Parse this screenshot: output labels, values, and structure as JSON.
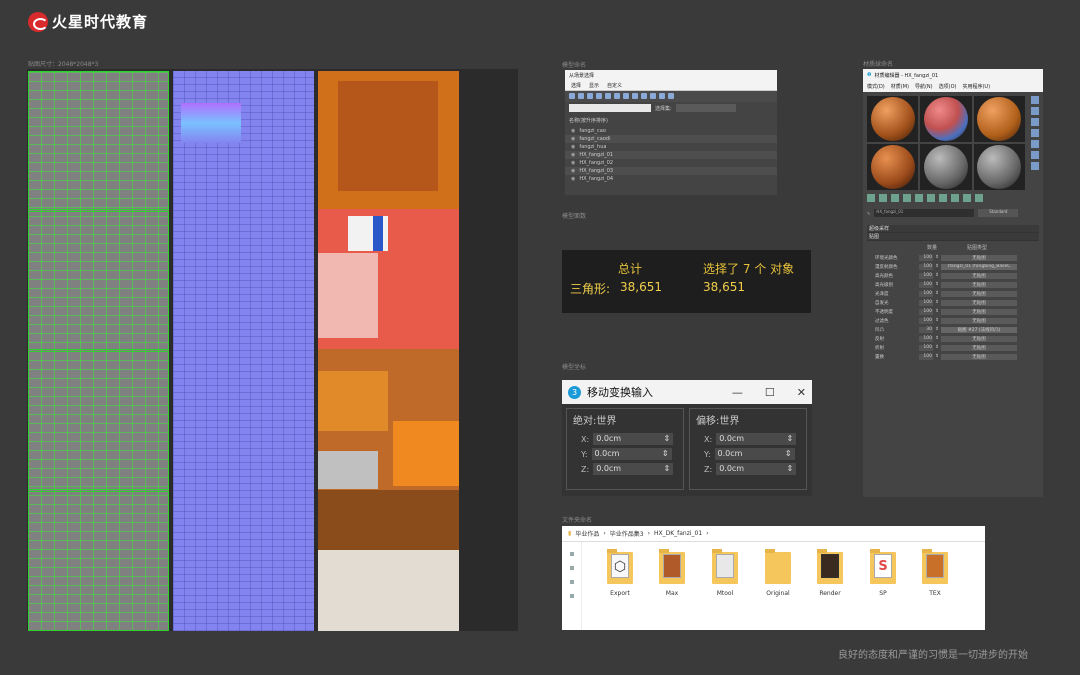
{
  "brand": {
    "logo_text": "火星时代教育"
  },
  "captions": {
    "texture": "贴图尺寸：2048*2048*3",
    "scene": "模型命名",
    "stats": "模型面数",
    "transform": "模型坐标",
    "material": "材质球命名",
    "files": "文件夹命名"
  },
  "scene_explorer": {
    "title": "从场景选择",
    "menus": [
      "选择",
      "显示",
      "自定义"
    ],
    "selection_set_label": "选择集:",
    "column_header": "名称(按升序排序)",
    "objects": [
      "fangzi_cao",
      "fangzi_caodi",
      "fangzi_hua",
      "HX_fangzi_01",
      "HX_fangzi_02",
      "HX_fangzi_03",
      "HX_fangzi_04"
    ]
  },
  "stats": {
    "total_label": "总计",
    "selected_label": "选择了 7 个 对象",
    "tri_label": "三角形:",
    "total_value": "38,651",
    "selected_value": "38,651"
  },
  "move_transform": {
    "title": "移动变换输入",
    "app_badge": "3",
    "absolute_label": "绝对:世界",
    "offset_label": "偏移:世界",
    "absolute": [
      {
        "axis": "X:",
        "value": "0.0cm"
      },
      {
        "axis": "Y:",
        "value": "0.0cm"
      },
      {
        "axis": "Z:",
        "value": "0.0cm"
      }
    ],
    "offset": [
      {
        "axis": "X:",
        "value": "0.0cm"
      },
      {
        "axis": "Y:",
        "value": "0.0cm"
      },
      {
        "axis": "Z:",
        "value": "0.0cm"
      }
    ]
  },
  "material_editor": {
    "title": "材质编辑器 - HX_fangzi_01",
    "menus": [
      "模式(D)",
      "材质(M)",
      "导航(N)",
      "选项(O)",
      "实用程序(U)"
    ],
    "material_name": "HX_fangzi_01",
    "material_type": "Standard",
    "rollouts": [
      "超级采样",
      "贴图"
    ],
    "map_header": {
      "amount": "数量",
      "type": "贴图类型"
    },
    "maps": [
      {
        "name": "环境光颜色",
        "amount": "100",
        "type": "无贴图",
        "on": false
      },
      {
        "name": "漫反射颜色",
        "amount": "100",
        "type": "(fangzi_01 (fangbing_BaseC",
        "on": true
      },
      {
        "name": "高光颜色",
        "amount": "100",
        "type": "无贴图",
        "on": false
      },
      {
        "name": "高光级别",
        "amount": "100",
        "type": "无贴图",
        "on": false
      },
      {
        "name": "光泽度",
        "amount": "100",
        "type": "无贴图",
        "on": false
      },
      {
        "name": "自发光",
        "amount": "100",
        "type": "无贴图",
        "on": false
      },
      {
        "name": "不透明度",
        "amount": "100",
        "type": "无贴图",
        "on": false
      },
      {
        "name": "过滤色",
        "amount": "100",
        "type": "无贴图",
        "on": false
      },
      {
        "name": "凹凸",
        "amount": "30",
        "type": "贴图 #27 (法线凹凸)",
        "on": true
      },
      {
        "name": "反射",
        "amount": "100",
        "type": "无贴图",
        "on": false
      },
      {
        "name": "折射",
        "amount": "100",
        "type": "无贴图",
        "on": false
      },
      {
        "name": "置换",
        "amount": "100",
        "type": "无贴图",
        "on": false
      }
    ]
  },
  "file_explorer": {
    "path": [
      "毕业作品",
      "毕业作品集3",
      "HX_DK_fanzi_01"
    ],
    "folders": [
      "Export",
      "Max",
      "Mtool",
      "Original",
      "Render",
      "SP",
      "TEX"
    ]
  },
  "slogan": "良好的态度和严谨的习惯是一切进步的开始"
}
